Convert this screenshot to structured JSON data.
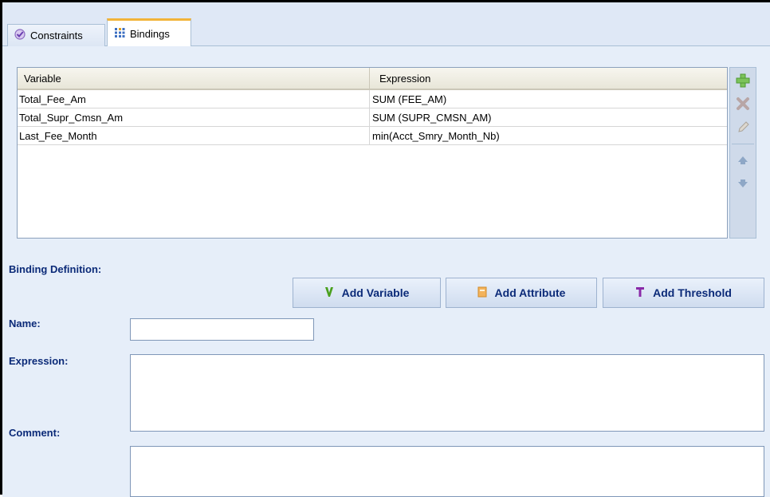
{
  "tabs": [
    {
      "label": "Constraints",
      "icon": "check-shield-icon",
      "active": false
    },
    {
      "label": "Bindings",
      "icon": "grid-dots-icon",
      "active": true
    }
  ],
  "table": {
    "headers": {
      "variable": "Variable",
      "expression": "Expression"
    },
    "rows": [
      {
        "variable": "Total_Fee_Am",
        "expression": "SUM (FEE_AM)"
      },
      {
        "variable": "Total_Supr_Cmsn_Am",
        "expression": "SUM (SUPR_CMSN_AM)"
      },
      {
        "variable": "Last_Fee_Month",
        "expression": "min(Acct_Smry_Month_Nb)"
      }
    ]
  },
  "toolbar": {
    "icons": [
      "plus-icon",
      "delete-x-icon",
      "pencil-icon",
      "arrow-up-icon",
      "arrow-down-icon"
    ]
  },
  "binding": {
    "section_title": "Binding Definition:",
    "add_variable": "Add Variable",
    "add_attribute": "Add Attribute",
    "add_threshold": "Add Threshold",
    "name_label": "Name:",
    "name_value": "",
    "expression_label": "Expression:",
    "expression_value": "",
    "comment_label": "Comment:",
    "comment_value": ""
  },
  "colors": {
    "accent": "#f2b43a",
    "label": "#0b2a78",
    "panel": "#e6eef9"
  }
}
